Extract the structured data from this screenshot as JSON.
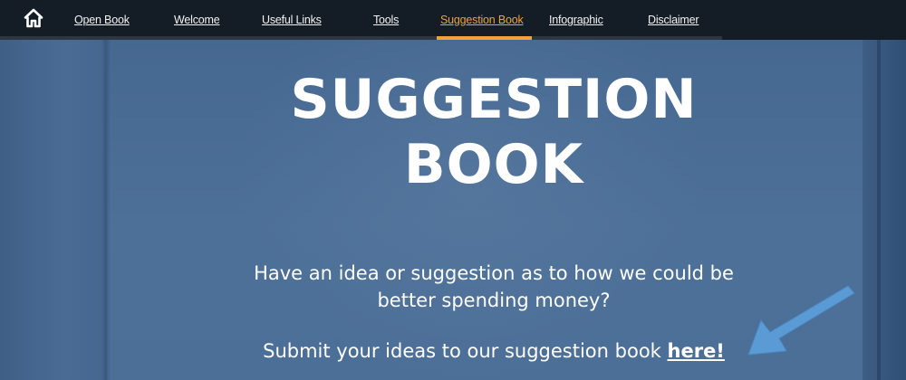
{
  "nav": {
    "home_icon": "home-icon",
    "items": [
      {
        "label": "Open Book"
      },
      {
        "label": "Welcome"
      },
      {
        "label": "Useful Links"
      },
      {
        "label": "Tools"
      },
      {
        "label": "Suggestion Book",
        "active": true
      },
      {
        "label": "Infographic"
      },
      {
        "label": "Disclaimer"
      }
    ]
  },
  "hero": {
    "title_line1": "SUGGESTION",
    "title_line2": "BOOK",
    "description": "Have an idea or suggestion as to how we could be better spending money?",
    "cta_text": "Submit your ideas to our suggestion book ",
    "cta_link": "here!"
  },
  "colors": {
    "nav_background": "#141c26",
    "active_accent": "#f0a23a",
    "hero_background": "#4a6a92",
    "arrow": "#5b9bd5",
    "text": "#ffffff"
  }
}
